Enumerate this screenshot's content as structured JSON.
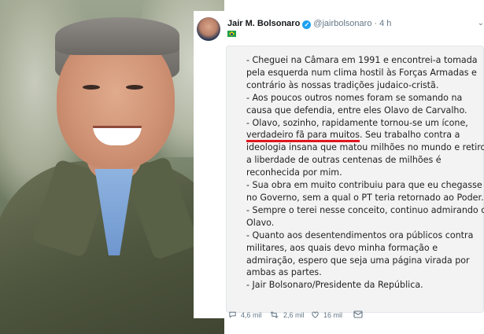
{
  "tweet": {
    "author_name": "Jair M. Bolsonaro",
    "handle": "@jairbolsonaro",
    "separator": "·",
    "time": "4 h",
    "lines": [
      "- Cheguei na Câmara em 1991 e encontrei-a tomada",
      "pela esquerda num clima hostil às Forças Armadas e",
      "contrário às nossas tradições judaico-cristã.",
      "- Aos poucos outros nomes foram se somando na",
      "causa que defendia, entre eles Olavo de Carvalho.",
      "- Olavo, sozinho, rapidamente tornou-se um ícone,",
      "",
      "ideologia insana que matou milhões no mundo e retirou",
      "a liberdade de outras centenas de milhões é",
      "reconhecida por mim.",
      "- Sua obra em muito contribuiu para que eu chegasse",
      "no Governo, sem a qual o PT teria retornado ao Poder.",
      "- Sempre o terei nesse conceito, continuo admirando o",
      "Olavo.",
      "- Quanto aos desentendimentos ora públicos contra",
      "militares, aos quais devo minha formação e",
      "admiração, espero que seja uma página virada por",
      "ambas as partes.",
      "- Jair Bolsonaro/Presidente da República."
    ],
    "underlined_phrase": "verdadeiro fã para muitos",
    "underlined_line_rest": ". Seu trabalho contra a",
    "actions": {
      "replies": "4,6 mil",
      "retweets": "2,6 mil",
      "likes": "16 mil"
    }
  },
  "icons": {
    "verified": "verified-badge-icon",
    "flag": "brazil-flag-icon",
    "chevron": "chevron-down-icon",
    "reply": "reply-icon",
    "retweet": "retweet-icon",
    "like": "heart-icon",
    "dm": "envelope-icon"
  },
  "colors": {
    "verified": "#1da1f2",
    "underline": "#e0161f",
    "muted_text": "#657786"
  }
}
